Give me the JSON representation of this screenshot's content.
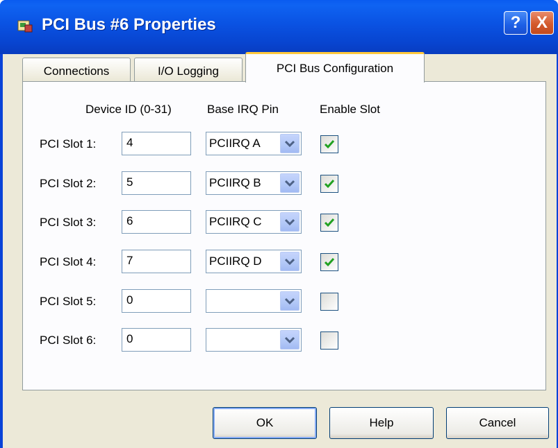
{
  "window": {
    "title": "PCI Bus #6 Properties",
    "help_glyph": "?",
    "close_glyph": "X"
  },
  "tabs": [
    {
      "label": "Connections",
      "active": false
    },
    {
      "label": "I/O Logging",
      "active": false
    },
    {
      "label": "PCI Bus Configuration",
      "active": true
    }
  ],
  "headers": {
    "device_id": "Device ID (0-31)",
    "base_irq": "Base IRQ Pin",
    "enable": "Enable Slot"
  },
  "slots": [
    {
      "label": "PCI Slot 1:",
      "device_id": "4",
      "irq": "PCIIRQ A",
      "enabled": true
    },
    {
      "label": "PCI Slot 2:",
      "device_id": "5",
      "irq": "PCIIRQ B",
      "enabled": true
    },
    {
      "label": "PCI Slot 3:",
      "device_id": "6",
      "irq": "PCIIRQ C",
      "enabled": true
    },
    {
      "label": "PCI Slot 4:",
      "device_id": "7",
      "irq": "PCIIRQ D",
      "enabled": true
    },
    {
      "label": "PCI Slot 5:",
      "device_id": "0",
      "irq": "",
      "enabled": false
    },
    {
      "label": "PCI Slot 6:",
      "device_id": "0",
      "irq": "",
      "enabled": false
    }
  ],
  "buttons": {
    "ok": "OK",
    "help": "Help",
    "cancel": "Cancel"
  },
  "colors": {
    "titlebar": "#0a52e2",
    "check": "#21a121",
    "tab_highlight": "#ffc83c"
  }
}
